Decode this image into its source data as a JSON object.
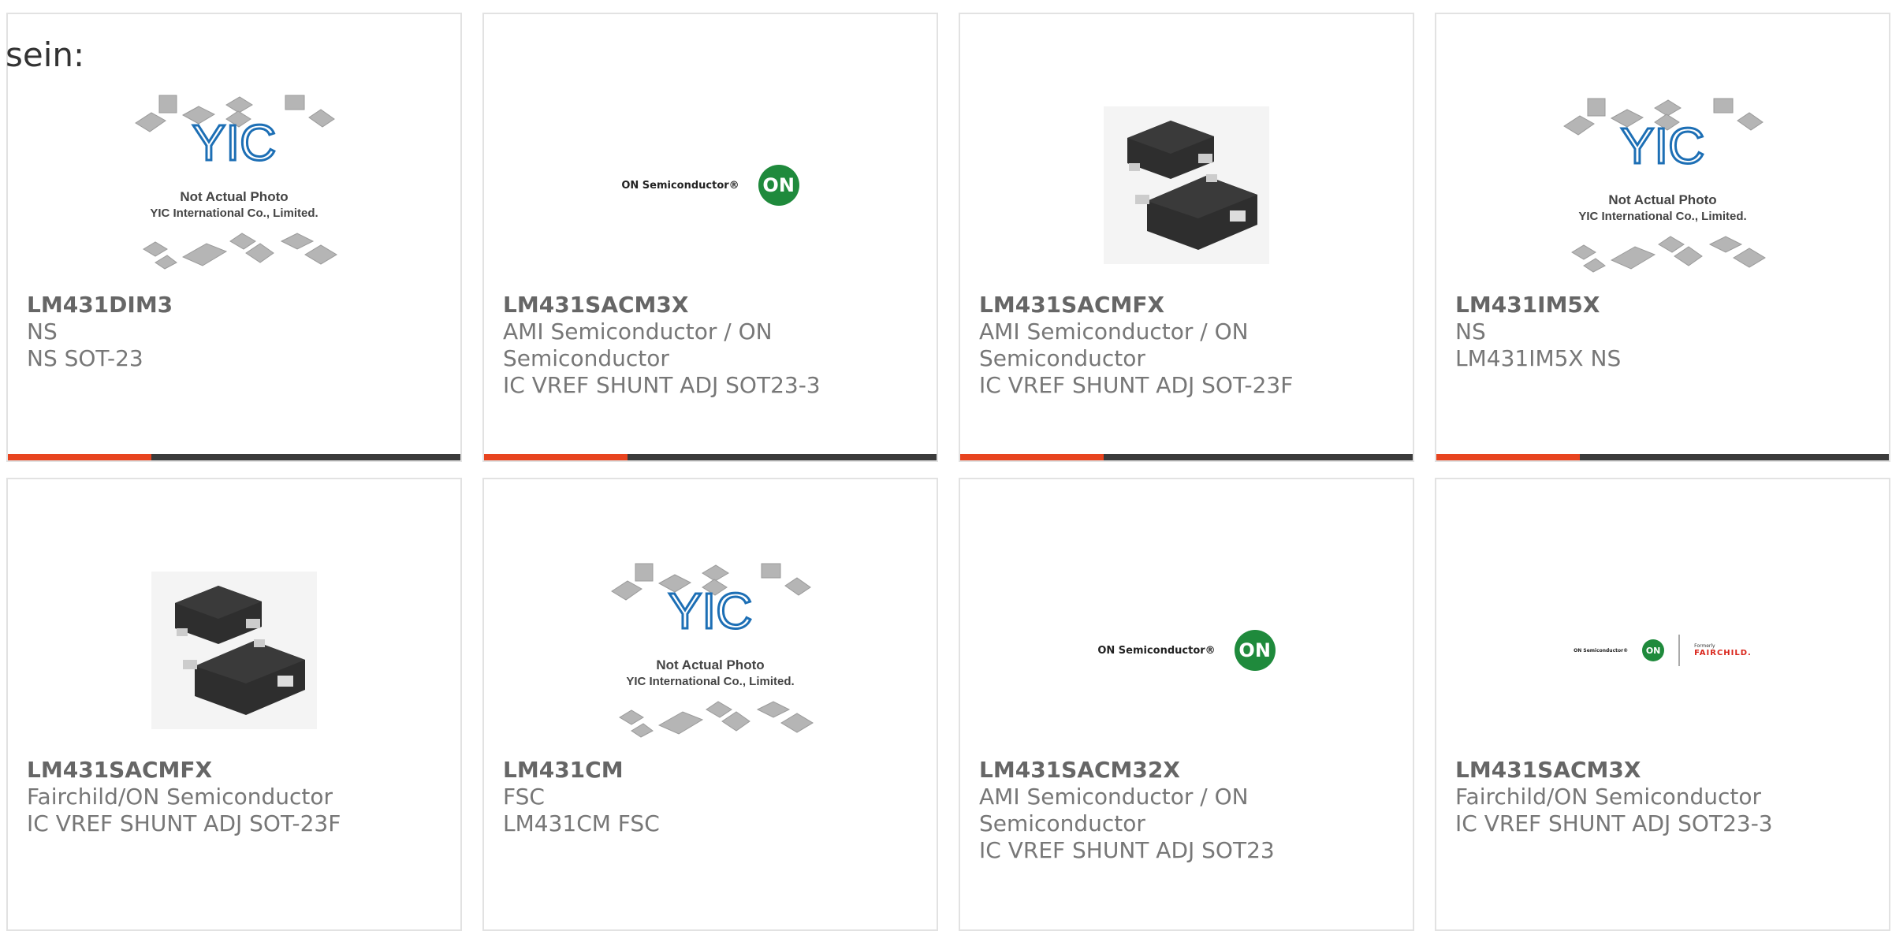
{
  "intro_text": "sein:",
  "colors": {
    "accent": "#e8441f",
    "bar": "#3b3b3b",
    "on_green": "#1f8a3c"
  },
  "placeholder_image": {
    "line1": "Not Actual Photo",
    "line2": "YIC International Co., Limited.",
    "logo_text": "YIC"
  },
  "on_logo": {
    "text": "ON Semiconductor®",
    "mark": "ON"
  },
  "fairchild_logo": {
    "text": "ON Semiconductor®",
    "mark": "ON",
    "formerly": "Formerly",
    "brand": "FAIRCHILD."
  },
  "products": [
    {
      "part": "LM431DIM3",
      "manufacturer": "NS",
      "description": "NS SOT-23",
      "image": "placeholder"
    },
    {
      "part": "LM431SACM3X",
      "manufacturer": "AMI Semiconductor / ON Semiconductor",
      "description": "IC VREF SHUNT ADJ SOT23-3",
      "image": "on-logo"
    },
    {
      "part": "LM431SACMFX",
      "manufacturer": "AMI Semiconductor / ON Semiconductor",
      "description": "IC VREF SHUNT ADJ SOT-23F",
      "image": "chip"
    },
    {
      "part": "LM431IM5X",
      "manufacturer": "NS",
      "description": "LM431IM5X NS",
      "image": "placeholder"
    },
    {
      "part": "LM431SACMFX",
      "manufacturer": "Fairchild/ON Semiconductor",
      "description": "IC VREF SHUNT ADJ SOT-23F",
      "image": "chip"
    },
    {
      "part": "LM431CM",
      "manufacturer": "FSC",
      "description": "LM431CM FSC",
      "image": "placeholder"
    },
    {
      "part": "LM431SACM32X",
      "manufacturer": "AMI Semiconductor / ON Semiconductor",
      "description": "IC VREF SHUNT ADJ SOT23",
      "image": "on-logo"
    },
    {
      "part": "LM431SACM3X",
      "manufacturer": "Fairchild/ON Semiconductor",
      "description": "IC VREF SHUNT ADJ SOT23-3",
      "image": "fairchild-logo"
    }
  ]
}
